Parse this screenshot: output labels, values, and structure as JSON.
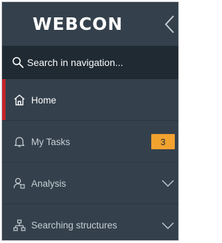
{
  "header": {
    "logo_text": "WEBCON",
    "collapse_icon": "chevron-left-icon"
  },
  "search": {
    "placeholder": "Search in navigation...",
    "icon": "search-icon"
  },
  "nav": {
    "items": [
      {
        "label": "Home",
        "icon": "home-icon",
        "active": true
      },
      {
        "label": "My Tasks",
        "icon": "bell-icon",
        "badge": "3"
      },
      {
        "label": "Analysis",
        "icon": "user-search-icon",
        "expandable": true
      },
      {
        "label": "Searching structures",
        "icon": "hierarchy-icon",
        "expandable": true
      }
    ]
  },
  "colors": {
    "background": "#34414c",
    "search_background": "#1f2a33",
    "active_accent": "#c3252c",
    "badge": "#f2a22f",
    "text": "#c7ced4",
    "text_active": "#ffffff"
  }
}
